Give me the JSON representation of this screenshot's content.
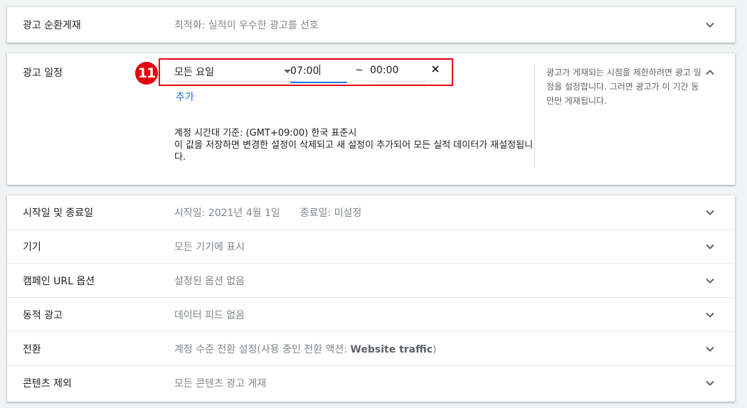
{
  "rotation": {
    "label": "광고 순환게재",
    "summary": "최적화: 실적이 우수한 광고를 선호"
  },
  "schedule": {
    "label": "광고 일정",
    "badge": "11",
    "day_value": "모든 요일",
    "start_time": "07:00",
    "tilde": "~",
    "end_time": "00:00",
    "add_label": "추가",
    "tz_line1": "계정 시간대 기준: (GMT+09:00) 한국 표준시",
    "tz_line2": "이 값을 저장하면 변경한 설정이 삭제되고 새 설정이 추가되어 모든 실적 데이터가 재설정됩니다.",
    "help": "광고가 게재되는 시점을 제한하려면 광고 일정을 설정합니다. 그러면 광고가 이 기간 동안만 게재됩니다."
  },
  "rows": [
    {
      "label": "시작일 및 종료일",
      "summary_start": "시작일: 2021년 4월 1일",
      "summary_end": "종료일: 미설정"
    },
    {
      "label": "기기",
      "summary": "모든 기기에 표시"
    },
    {
      "label": "캠페인 URL 옵션",
      "summary": "설정된 옵션 없음"
    },
    {
      "label": "동적 광고",
      "summary": "데이터 피드 없음"
    },
    {
      "label": "전환",
      "summary_prefix": "계정 수준 전환 설정(사용 중인 전환 액션: ",
      "summary_bold": "Website traffic",
      "summary_suffix": ")"
    },
    {
      "label": "콘텐츠 제외",
      "summary": "모든 콘텐츠 광고 게재"
    }
  ],
  "icons": {
    "expand": "chevron-down-icon",
    "collapse": "chevron-up-icon",
    "remove": "close-icon",
    "dropdown": "caret-down-icon"
  },
  "colors": {
    "accent": "#1a73e8",
    "highlight": "#e3000f"
  }
}
